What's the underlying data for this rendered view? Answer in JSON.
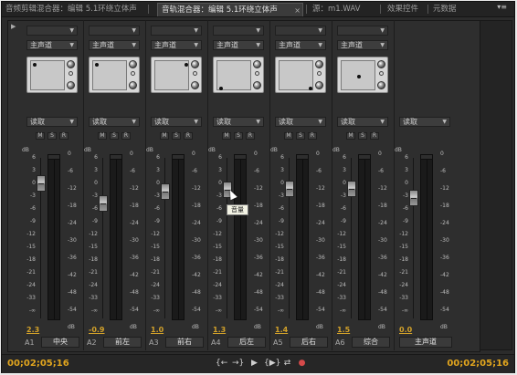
{
  "tabs": [
    {
      "label": "音频剪辑混合器：编辑 5.1环绕立体声",
      "active": false
    },
    {
      "label": "音轨混合器：编辑 5.1环绕立体声",
      "active": true
    },
    {
      "label": "源：m1.WAV",
      "active": false
    },
    {
      "label": "效果控件",
      "active": false
    },
    {
      "label": "元数据",
      "active": false
    }
  ],
  "close_glyph": "×",
  "panel_menu_glyph": "▾≡",
  "expander_glyph": "▶",
  "mute_label": "M",
  "solo_label": "S",
  "record_label": "R",
  "db_label": "dB",
  "left_scale": [
    "6",
    "3",
    "0",
    "-3",
    "-6",
    "-9",
    "-12",
    "-15",
    "-18",
    "-21",
    "-24",
    "-33",
    "-∞"
  ],
  "right_scale": [
    "0",
    "-6",
    "-12",
    "-18",
    "-24",
    "-30",
    "-36",
    "-42",
    "-48",
    "-54",
    "dB"
  ],
  "tracks": [
    {
      "id": "A1",
      "routing": "主声道",
      "automation": "读取",
      "volume": "2.3",
      "volume_db": 2.3,
      "name": "中央",
      "panner_dot": "top-left"
    },
    {
      "id": "A2",
      "routing": "主声道",
      "automation": "读取",
      "volume": "-0.9",
      "volume_db": -0.9,
      "name": "前左",
      "panner_dot": "top-left"
    },
    {
      "id": "A3",
      "routing": "主声道",
      "automation": "读取",
      "volume": "1.0",
      "volume_db": 1.0,
      "name": "前右",
      "panner_dot": "top-right"
    },
    {
      "id": "A4",
      "routing": "主声道",
      "automation": "读取",
      "volume": "1.3",
      "volume_db": 1.3,
      "name": "后左",
      "panner_dot": "bottom-left"
    },
    {
      "id": "A5",
      "routing": "主声道",
      "automation": "读取",
      "volume": "1.4",
      "volume_db": 1.4,
      "name": "后右",
      "panner_dot": "bottom-right"
    },
    {
      "id": "A6",
      "routing": "主声道",
      "automation": "读取",
      "volume": "1.5",
      "volume_db": 1.5,
      "name": "综合",
      "panner_dot": "center"
    }
  ],
  "master": {
    "automation": "读取",
    "volume": "0.0",
    "volume_db": 0.0,
    "name": "主声道"
  },
  "tooltip": "音量",
  "transport": {
    "current_time": "00;02;05;16",
    "duration": "00;02;05;16",
    "buttons": [
      "{←",
      "→}",
      "▶",
      "{▶}",
      "⇄",
      "●"
    ]
  },
  "colors": {
    "accent": "#e1a51e",
    "volume_value": "#d3a22a",
    "record_button": "#d64a4a"
  }
}
